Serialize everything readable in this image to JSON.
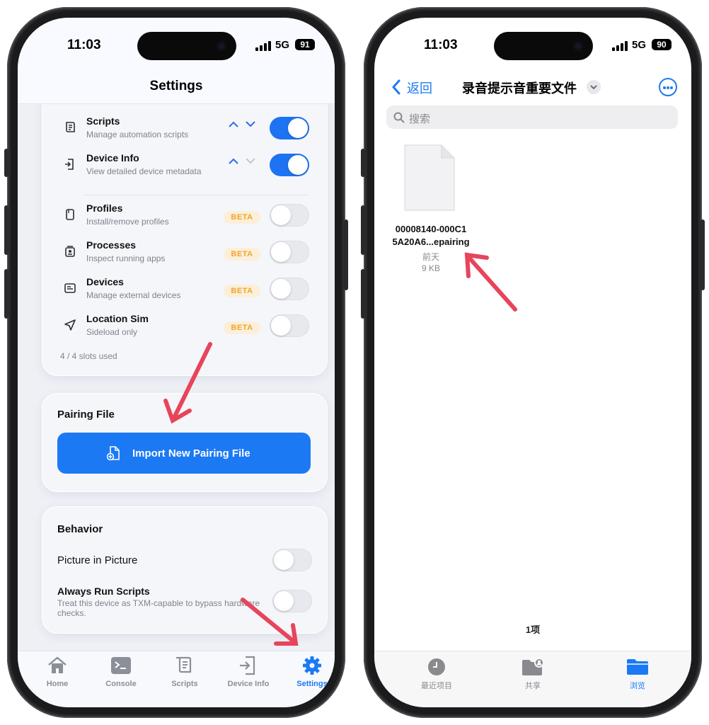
{
  "left_phone": {
    "status": {
      "time": "11:03",
      "network": "5G",
      "battery": "91"
    },
    "nav_title": "Settings",
    "features": [
      {
        "icon": "scroll-icon",
        "title": "Scripts",
        "subtitle": "Manage automation scripts",
        "enabled": true
      },
      {
        "icon": "device-info-icon",
        "title": "Device Info",
        "subtitle": "View detailed device metadata",
        "enabled": true
      },
      {
        "icon": "profile-icon",
        "title": "Profiles",
        "subtitle": "Install/remove profiles",
        "badge": "BETA",
        "enabled": false
      },
      {
        "icon": "processes-icon",
        "title": "Processes",
        "subtitle": "Inspect running apps",
        "badge": "BETA",
        "enabled": false
      },
      {
        "icon": "devices-icon",
        "title": "Devices",
        "subtitle": "Manage external devices",
        "badge": "BETA",
        "enabled": false
      },
      {
        "icon": "location-icon",
        "title": "Location Sim",
        "subtitle": "Sideload only",
        "badge": "BETA",
        "enabled": false
      }
    ],
    "slots_used": "4 / 4 slots used",
    "pairing": {
      "heading": "Pairing File",
      "button_label": "Import New Pairing File"
    },
    "behavior": {
      "heading": "Behavior",
      "pip_label": "Picture in Picture",
      "pip_enabled": false,
      "always_run_label": "Always Run Scripts",
      "always_run_subtitle": "Treat this device as TXM-capable to bypass hardware checks.",
      "always_run_enabled": false
    },
    "tabs": [
      {
        "label": "Home",
        "icon": "home-icon",
        "active": false
      },
      {
        "label": "Console",
        "icon": "console-icon",
        "active": false
      },
      {
        "label": "Scripts",
        "icon": "scroll-icon",
        "active": false
      },
      {
        "label": "Device Info",
        "icon": "device-info-icon",
        "active": false
      },
      {
        "label": "Settings",
        "icon": "gear-icon",
        "active": true
      }
    ],
    "accent": "#1c79f4",
    "badge_color": "#f0a52a"
  },
  "right_phone": {
    "status": {
      "time": "11:03",
      "network": "5G",
      "battery": "90"
    },
    "back_label": "返回",
    "folder_title": "录音提示音重要文件",
    "search_placeholder": "搜索",
    "file": {
      "name_line1": "00008140-000C1",
      "name_line2": "5A20A6...epairing",
      "date": "前天",
      "size": "9 KB"
    },
    "item_count": "1项",
    "tabs": [
      {
        "label": "最近项目",
        "icon": "clock-icon",
        "active": false
      },
      {
        "label": "共享",
        "icon": "shared-folder-icon",
        "active": false
      },
      {
        "label": "浏览",
        "icon": "folder-icon",
        "active": true
      }
    ]
  },
  "annotation_color": "#e8445a"
}
